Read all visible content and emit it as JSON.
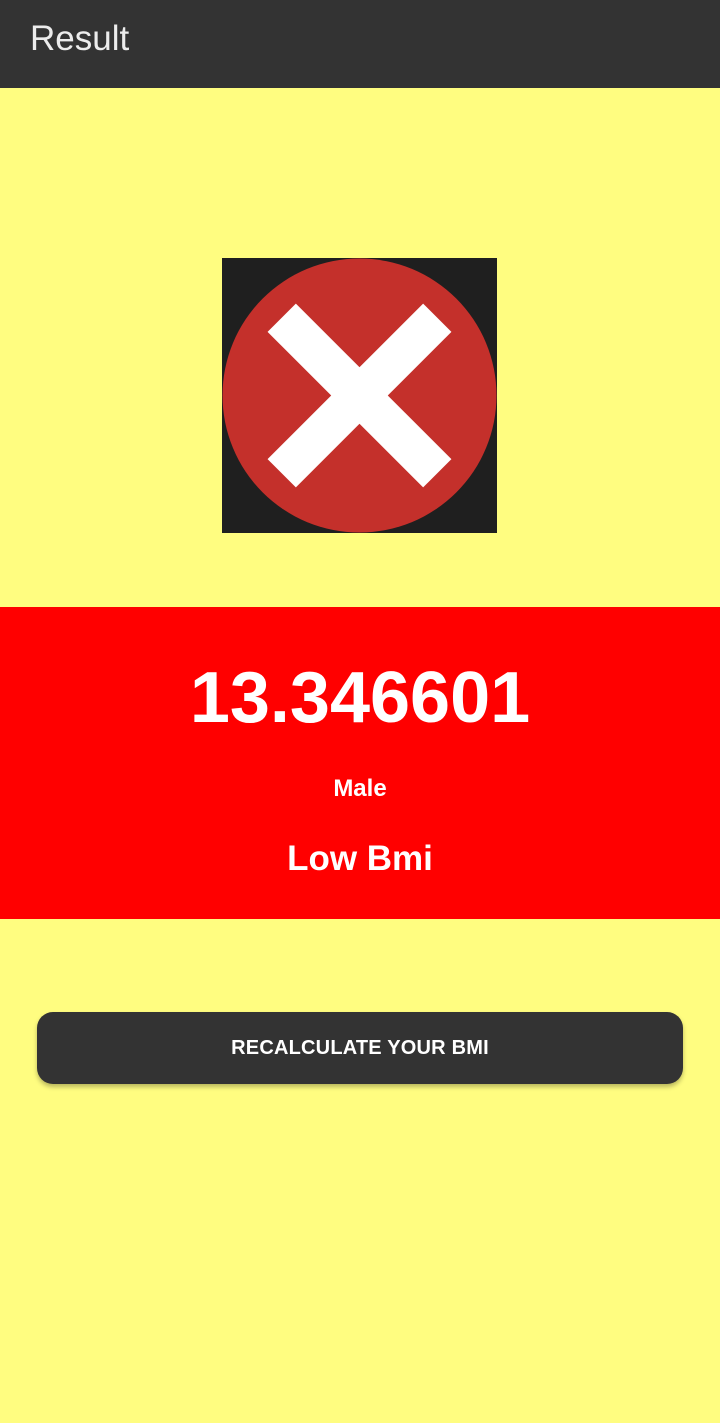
{
  "app_bar": {
    "title": "Result"
  },
  "status": {
    "icon": "close-circle-icon",
    "icon_color": "#c4302b",
    "icon_mark_color": "#ffffff",
    "icon_background": "#1f1f1f"
  },
  "result": {
    "bmi_value": "13.346601",
    "gender": "Male",
    "category": "Low Bmi",
    "panel_color": "#ff0000"
  },
  "actions": {
    "recalculate_label": "RECALCULATE YOUR BMI"
  },
  "colors": {
    "background": "#fffd80",
    "app_bar": "#333333",
    "button": "#333333"
  }
}
